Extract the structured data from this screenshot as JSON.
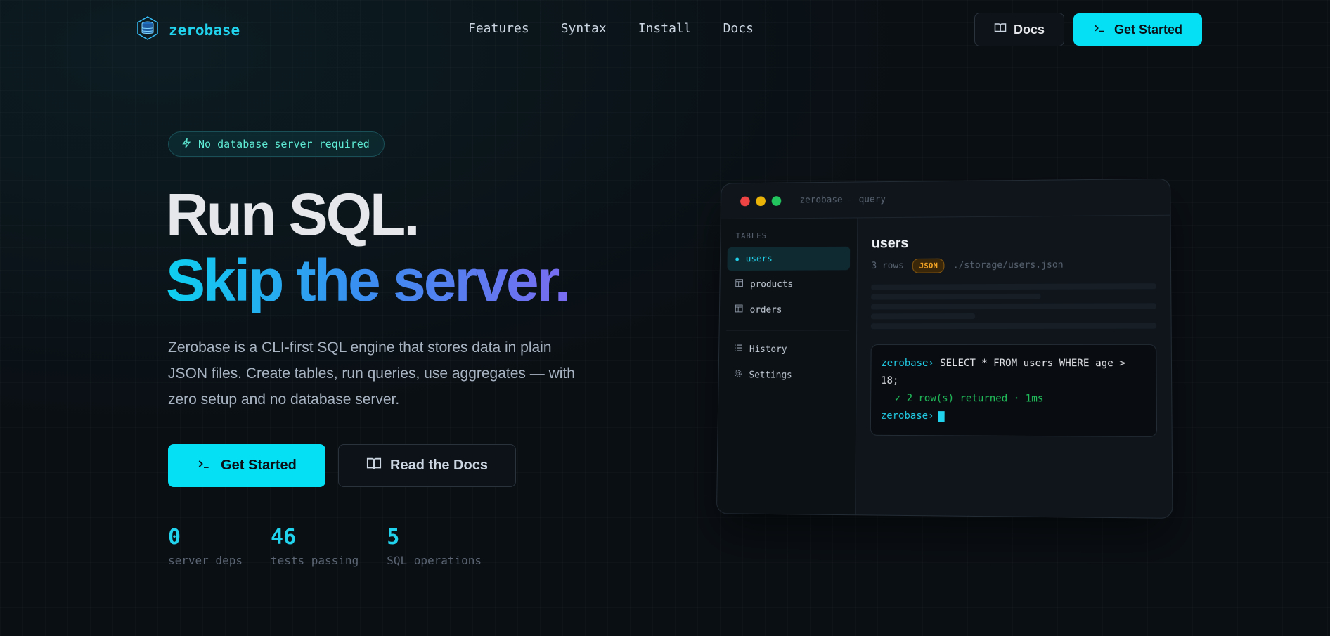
{
  "brand": {
    "name": "zerobase"
  },
  "nav": {
    "links": [
      "Features",
      "Syntax",
      "Install",
      "Docs"
    ]
  },
  "header": {
    "docs_label": "Docs",
    "start_label": "Get Started"
  },
  "hero": {
    "badge": "No database server required",
    "title_line1": "Run SQL.",
    "title_line2": "Skip the server.",
    "lead": "Zerobase is a CLI-first SQL engine that stores data in plain JSON files. Create tables, run queries, use aggregates — with zero setup and no database server.",
    "cta_primary": "Get Started",
    "cta_secondary": "Read the Docs"
  },
  "stats": [
    {
      "value": "0",
      "label": "server deps"
    },
    {
      "value": "46",
      "label": "tests passing"
    },
    {
      "value": "5",
      "label": "SQL operations"
    }
  ],
  "window": {
    "title": "zerobase — query",
    "sidebar_heading": "TABLES",
    "tables": [
      "users",
      "products",
      "orders"
    ],
    "extra": [
      "History",
      "Settings"
    ],
    "table_name": "users",
    "row_count": "3 rows",
    "format_pill": "JSON",
    "path": "./storage/users.json",
    "prompt": "zerobase›",
    "command": "SELECT * FROM users WHERE age > 18;",
    "result": "✓ 2 row(s) returned · 1ms"
  },
  "colors": {
    "accent": "#06e0f5",
    "pill": "#f5a524",
    "ok": "#22c55e"
  }
}
